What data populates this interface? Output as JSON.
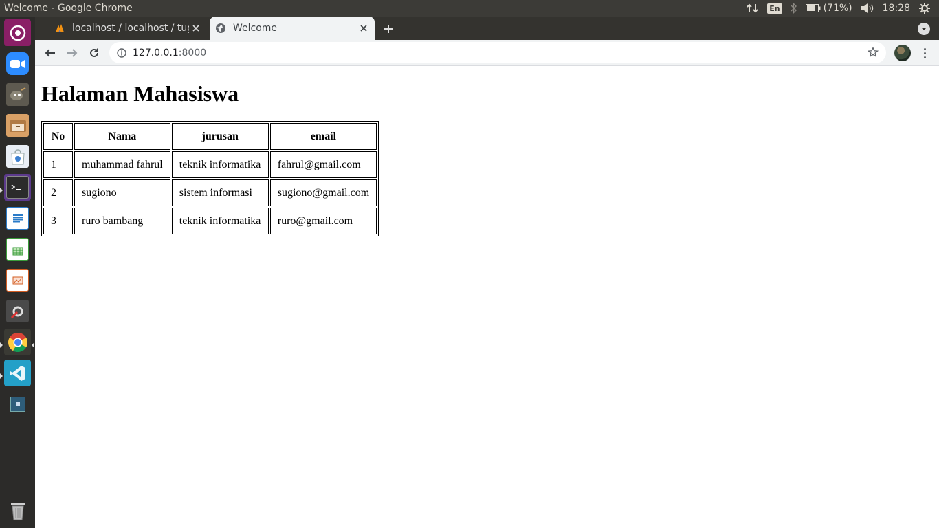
{
  "system": {
    "window_title": "Welcome - Google Chrome",
    "language": "En",
    "battery": "(71%)",
    "clock": "18:28"
  },
  "launcher": {
    "apps": [
      "ubuntu-dash-icon",
      "zoom-icon",
      "gimp-icon",
      "files-icon",
      "software-center-icon",
      "terminal-icon",
      "writer-icon",
      "calc-icon",
      "impress-icon",
      "settings-icon",
      "chrome-icon",
      "vscode-icon",
      "workspace-switcher-icon",
      "trash-icon"
    ]
  },
  "browser": {
    "tabs": [
      {
        "label": "localhost / localhost / tug",
        "icon": "phpmyadmin-icon",
        "active": false
      },
      {
        "label": "Welcome",
        "icon": "globe-icon",
        "active": true
      }
    ],
    "url_host": "127.0.0.1",
    "url_port": ":8000"
  },
  "page": {
    "heading": "Halaman Mahasiswa",
    "table": {
      "headers": [
        "No",
        "Nama",
        "jurusan",
        "email"
      ],
      "rows": [
        [
          "1",
          "muhammad fahrul",
          "teknik informatika",
          "fahrul@gmail.com"
        ],
        [
          "2",
          "sugiono",
          "sistem informasi",
          "sugiono@gmail.com"
        ],
        [
          "3",
          "ruro bambang",
          "teknik informatika",
          "ruro@gmail.com"
        ]
      ]
    }
  }
}
